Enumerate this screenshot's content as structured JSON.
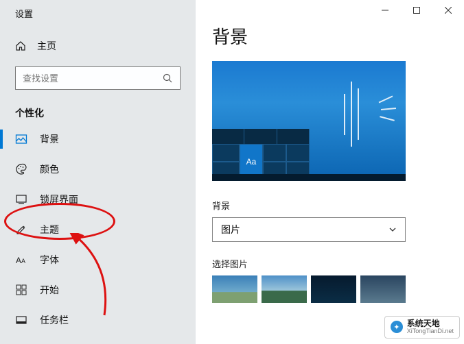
{
  "window": {
    "title": "设置"
  },
  "sidebar": {
    "home": "主页",
    "search_placeholder": "查找设置",
    "section": "个性化",
    "items": [
      {
        "label": "背景"
      },
      {
        "label": "颜色"
      },
      {
        "label": "锁屏界面"
      },
      {
        "label": "主题"
      },
      {
        "label": "字体"
      },
      {
        "label": "开始"
      },
      {
        "label": "任务栏"
      }
    ]
  },
  "main": {
    "title": "背景",
    "preview_tile_text": "Aa",
    "bg_label": "背景",
    "bg_value": "图片",
    "choose_label": "选择图片"
  },
  "watermark": {
    "cn": "系统天地",
    "en": "XiTongTianDi.net"
  }
}
